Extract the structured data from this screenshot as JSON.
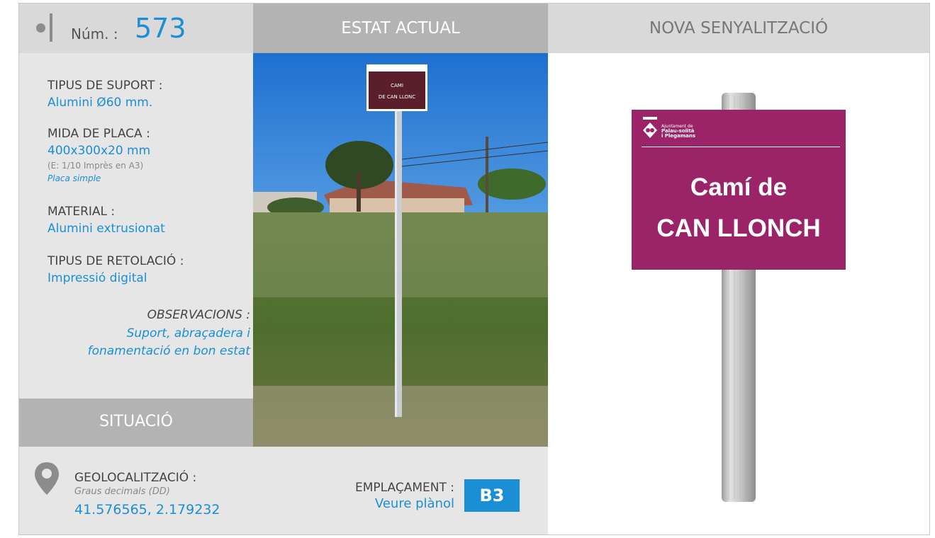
{
  "header": {
    "num_label": "Núm. :",
    "num_value": "573",
    "current_state_title": "ESTAT ACTUAL",
    "new_signage_title": "NOVA SENYALITZACIÓ"
  },
  "specs": {
    "support_type_label": "TIPUS DE SUPORT :",
    "support_type_value": "Alumini Ø60 mm.",
    "plate_size_label": "MIDA DE PLACA :",
    "plate_size_value": "400x300x20 mm",
    "plate_size_note": "(E: 1/10 Imprès en A3)",
    "plate_type": "Placa simple",
    "material_label": "MATERIAL :",
    "material_value": "Alumini extrusionat",
    "lettering_label": "TIPUS DE RETOLACIÓ :",
    "lettering_value": "Impressió digital",
    "observations_label": "OBSERVACIONS :",
    "observations_line1": "Suport, abraçadera i",
    "observations_line2": "fonamentació en bon estat"
  },
  "situation": {
    "title": "SITUACIÓ",
    "geo_label": "GEOLOCALITZACIÓ :",
    "geo_format": "Graus decimals (DD)",
    "geo_value": "41.576565, 2.179232",
    "location_label": "EMPLAÇAMENT :",
    "location_link": "Veure plànol",
    "location_code": "B3"
  },
  "photo": {
    "sign_line1": "CAMI",
    "sign_line2": "DE CAN LLONC"
  },
  "new_sign": {
    "logo_line1": "Ajuntament de",
    "logo_line2": "Palau-solità",
    "logo_line3": "i Plegamans",
    "text_line1": "Camí de",
    "text_line2": "CAN LLONCH",
    "color": "#9b2468"
  },
  "colors": {
    "accent": "#1a8fd6",
    "header_dark": "#b3b3b3",
    "header_light": "#d9d9d9",
    "panel": "#e6e6e6"
  },
  "icons": [
    "pin-icon",
    "logo-icon"
  ]
}
